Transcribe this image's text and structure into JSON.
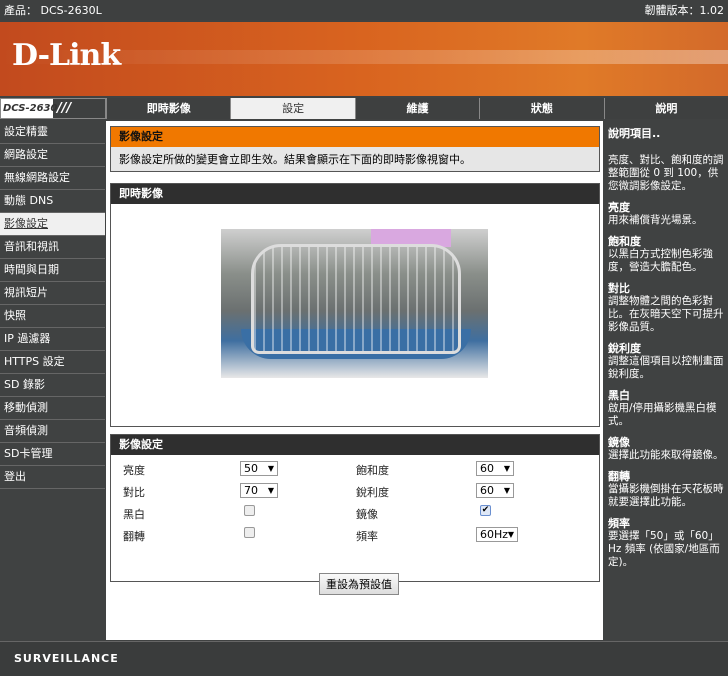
{
  "topbar": {
    "product": "產品： DCS-2630L",
    "firmware": "韌體版本：1.02"
  },
  "brand": {
    "logo": "D-Link",
    "model": "DCS-2630L",
    "footer": "SURVEILLANCE"
  },
  "tabs": [
    "即時影像",
    "設定",
    "維護",
    "狀態",
    "說明"
  ],
  "sidebar": [
    "設定精靈",
    "網路設定",
    "無線網路設定",
    "動態 DNS",
    "影像設定",
    "音訊和視訊",
    "時間與日期",
    "視訊短片",
    "快照",
    "IP 過濾器",
    "HTTPS 設定",
    "SD 錄影",
    "移動偵測",
    "音頻偵測",
    "SD卡管理",
    "登出"
  ],
  "intro": {
    "title": "影像設定",
    "text": "影像設定所做的變更會立即生效。結果會顯示在下面的即時影像視窗中。"
  },
  "live": {
    "title": "即時影像"
  },
  "settings": {
    "title": "影像設定",
    "brightness_label": "亮度",
    "brightness": "50",
    "saturation_label": "飽和度",
    "saturation": "60",
    "contrast_label": "對比",
    "contrast": "70",
    "sharpness_label": "銳利度",
    "sharpness": "60",
    "bw_label": "黑白",
    "mirror_label": "鏡像",
    "flip_label": "翻轉",
    "freq_label": "頻率",
    "freq": "60Hz",
    "reset": "重設為預設值"
  },
  "help": {
    "title": "說明項目..",
    "intro": "亮度、對比、飽和度的調整範圍從 0 到 100，供您微調影像設定。",
    "items": [
      {
        "h": "亮度",
        "t": "用來補償背光場景。"
      },
      {
        "h": "飽和度",
        "t": "以黑白方式控制色彩強度，營造大膽配色。"
      },
      {
        "h": "對比",
        "t": "調整物體之間的色彩對比。在灰暗天空下可提升影像品質。"
      },
      {
        "h": "銳利度",
        "t": "調整這個項目以控制畫面銳利度。"
      },
      {
        "h": "黑白",
        "t": "啟用/停用攝影機黑白模式。"
      },
      {
        "h": "鏡像",
        "t": "選擇此功能來取得鏡像。"
      },
      {
        "h": "翻轉",
        "t": "當攝影機倒掛在天花板時就要選擇此功能。"
      },
      {
        "h": "頻率",
        "t": "要選擇「50」或「60」Hz 頻率 (依國家/地區而定)。"
      }
    ]
  }
}
